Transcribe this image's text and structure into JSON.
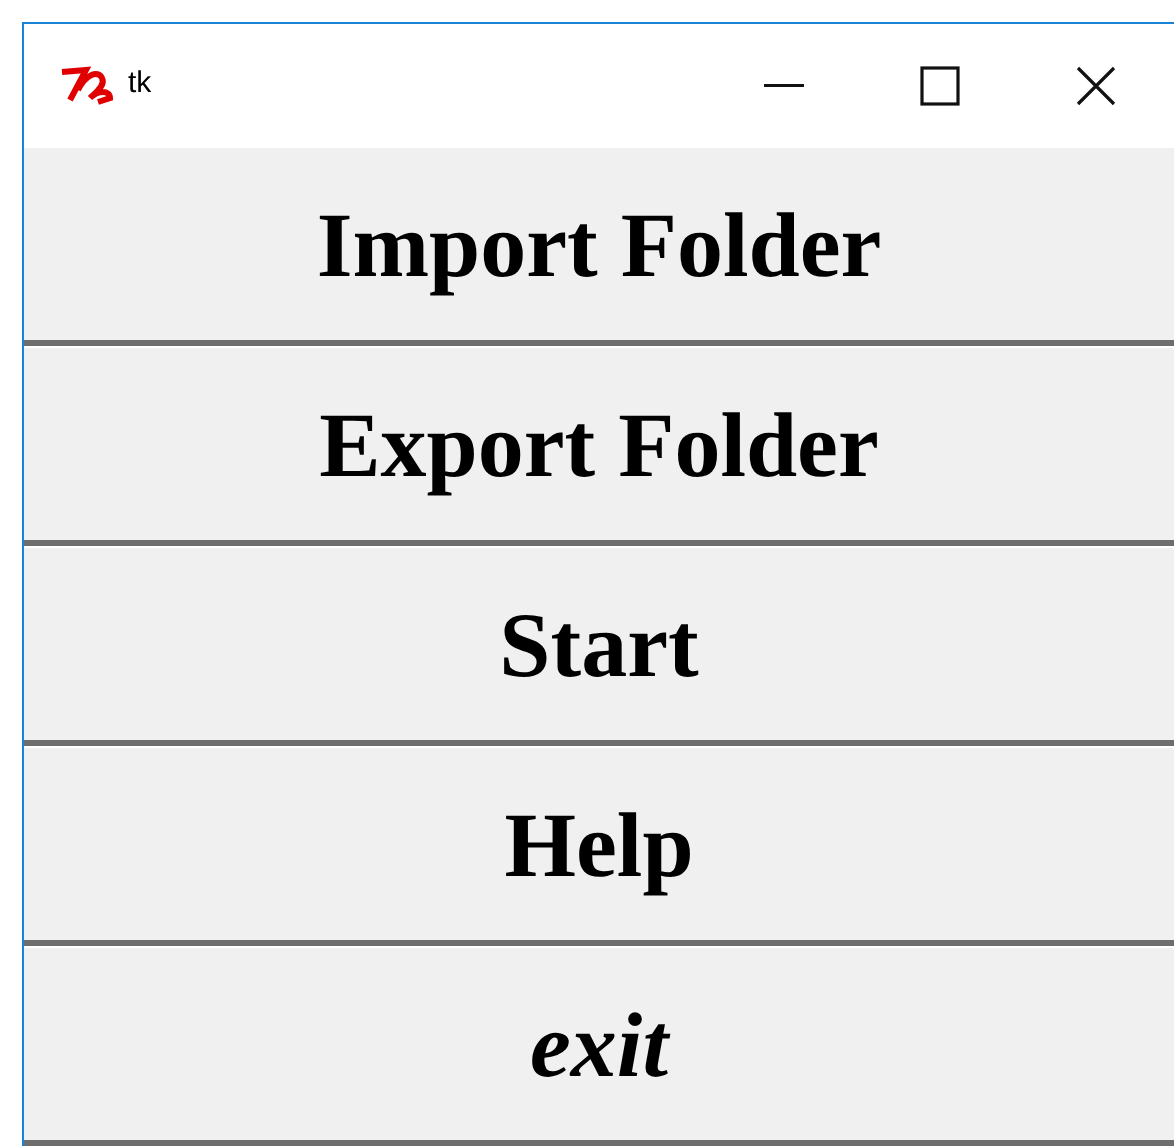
{
  "window": {
    "title": "tk"
  },
  "buttons": [
    {
      "label": "Import Folder",
      "italic": false
    },
    {
      "label": "Export Folder",
      "italic": false
    },
    {
      "label": "Start",
      "italic": false
    },
    {
      "label": "Help",
      "italic": false
    },
    {
      "label": "exit",
      "italic": true
    }
  ]
}
